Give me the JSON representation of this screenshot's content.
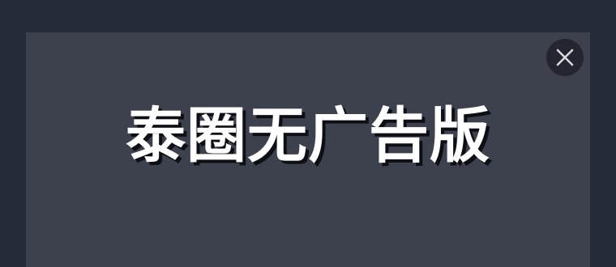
{
  "dialog": {
    "title": "泰圈无广告版"
  },
  "close_button": {
    "icon": "close-icon",
    "bg_color": "#23262e",
    "icon_color": "#d8d9dc"
  },
  "colors": {
    "backdrop": "#262b39",
    "dialog": "#3d414e",
    "title_text": "#ffffff",
    "title_shadow": "#0d0f14"
  }
}
